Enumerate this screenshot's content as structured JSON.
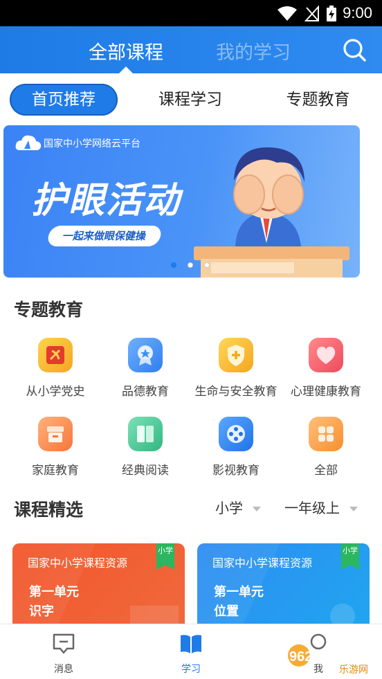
{
  "status_bar": {
    "time": "9:00"
  },
  "header": {
    "tabs": [
      {
        "label": "全部课程",
        "active": true
      },
      {
        "label": "我的学习",
        "active": false
      }
    ]
  },
  "sub_tabs": [
    {
      "label": "首页推荐",
      "active": true
    },
    {
      "label": "课程学习",
      "active": false
    },
    {
      "label": "专题教育",
      "active": false
    }
  ],
  "banner": {
    "platform": "国家中小学网络云平台",
    "title": "护眼活动",
    "subtitle": "一起来做眼保健操",
    "page_count": 3,
    "active_page": 1
  },
  "topics": {
    "title": "专题教育",
    "items": [
      {
        "label": "从小学党史",
        "icon": "party-emblem-icon",
        "color": "#f5b82e"
      },
      {
        "label": "品德教育",
        "icon": "medal-icon",
        "color": "#3d8ff5"
      },
      {
        "label": "生命与安全教育",
        "icon": "shield-icon",
        "color": "#f8b731"
      },
      {
        "label": "心理健康教育",
        "icon": "heart-icon",
        "color": "#f35b6a"
      },
      {
        "label": "家庭教育",
        "icon": "house-icon",
        "color": "#f8894b"
      },
      {
        "label": "经典阅读",
        "icon": "book-icon",
        "color": "#43c795"
      },
      {
        "label": "影视教育",
        "icon": "film-reel-icon",
        "color": "#2f86f3"
      },
      {
        "label": "全部",
        "icon": "grid-icon",
        "color": "#f9a34a"
      }
    ]
  },
  "courses": {
    "title": "课程精选",
    "filters": [
      "小学",
      "一年级上"
    ],
    "cards": [
      {
        "source": "国家中小学课程资源",
        "unit": "第一单元",
        "name": "识字",
        "tag": "小学",
        "color": "#f05a2c"
      },
      {
        "source": "国家中小学课程资源",
        "unit": "第一单元",
        "name": "位置",
        "tag": "小学",
        "color": "#2796ee"
      }
    ]
  },
  "bottom_nav": [
    {
      "label": "消息",
      "icon": "message-icon",
      "active": false
    },
    {
      "label": "学习",
      "icon": "open-book-icon",
      "active": true
    },
    {
      "label": "我",
      "icon": "profile-icon",
      "active": false
    }
  ],
  "watermark": {
    "brand": "962.NET",
    "site": "乐游网"
  },
  "colors": {
    "primary": "#1f7be8",
    "header": "#2f8bf0"
  }
}
